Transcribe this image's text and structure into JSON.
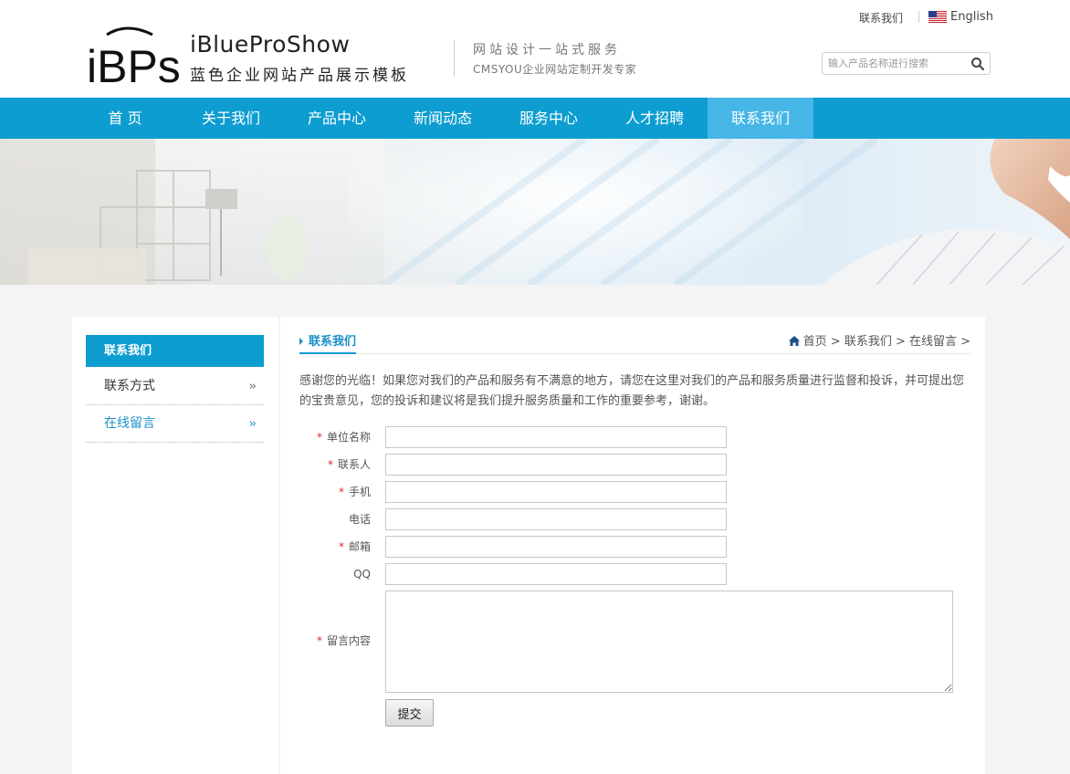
{
  "header": {
    "logo_mark": "iBPs",
    "logo_title": "iBlueProShow",
    "logo_subtitle": "蓝色企业网站产品展示模板",
    "slogan_line1": "网站设计一站式服务",
    "slogan_line2": "CMSYOU企业网站定制开发专家",
    "top_links": {
      "contact": "联系我们",
      "english": "English"
    },
    "search": {
      "placeholder": "输入产品名称进行搜索"
    }
  },
  "nav": {
    "items": [
      {
        "label": "首 页"
      },
      {
        "label": "关于我们"
      },
      {
        "label": "产品中心"
      },
      {
        "label": "新闻动态"
      },
      {
        "label": "服务中心"
      },
      {
        "label": "人才招聘"
      },
      {
        "label": "联系我们",
        "active": true
      }
    ]
  },
  "sidebar": {
    "heading": "联系我们",
    "items": [
      {
        "label": "联系方式",
        "chevron": "›› "
      },
      {
        "label": "在线留言",
        "active": true,
        "chevron": "›› "
      }
    ]
  },
  "main": {
    "title": "联系我们",
    "breadcrumb": "首页 > 联系我们 > 在线留言 >",
    "intro": "感谢您的光临！如果您对我们的产品和服务有不满意的地方，请您在这里对我们的产品和服务质量进行监督和投诉，并可提出您的宝贵意见，您的投诉和建议将是我们提升服务质量和工作的重要参考，谢谢。",
    "form": {
      "required_mark": "*",
      "fields": [
        {
          "label": "单位名称",
          "required": true,
          "value": ""
        },
        {
          "label": "联系人",
          "required": true,
          "value": ""
        },
        {
          "label": "手机",
          "required": true,
          "value": ""
        },
        {
          "label": "电话",
          "required": false,
          "value": ""
        },
        {
          "label": "邮箱",
          "required": true,
          "value": ""
        },
        {
          "label": "QQ",
          "required": false,
          "value": ""
        }
      ],
      "message_label": "留言内容",
      "message_value": "",
      "submit_label": "提交"
    }
  },
  "colors": {
    "brand_blue": "#0d9dd0",
    "nav_active": "#45b6e6",
    "link_blue": "#1a8fc7",
    "required_red": "#e02a2a"
  },
  "icons": [
    "search-icon",
    "us-flag-icon",
    "home-icon",
    "chevron-right-double-icon"
  ]
}
